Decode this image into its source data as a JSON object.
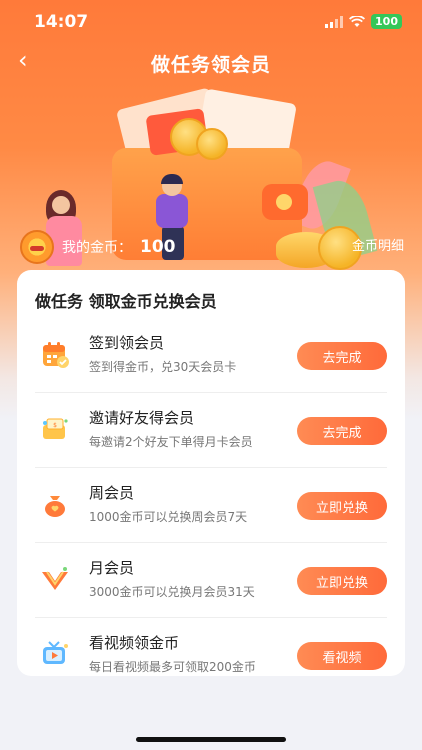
{
  "status": {
    "time": "14:07",
    "battery": "100"
  },
  "nav": {
    "back": "‹",
    "title": "做任务领会员"
  },
  "wallet": {
    "label": "我的金币：",
    "value": "100",
    "detail_link": "金币明细"
  },
  "card": {
    "title": "做任务  领取金币兑换会员",
    "tasks": [
      {
        "name": "签到领会员",
        "desc": "签到得金币，兑30天会员卡",
        "action": "去完成",
        "icon": "calendar-icon"
      },
      {
        "name": "邀请好友得会员",
        "desc": "每邀请2个好友下单得月卡会员",
        "action": "去完成",
        "icon": "invite-gift-icon"
      },
      {
        "name": "周会员",
        "desc": "1000金币可以兑换周会员7天",
        "action": "立即兑换",
        "icon": "money-bag-icon"
      },
      {
        "name": "月会员",
        "desc": "3000金币可以兑换月会员31天",
        "action": "立即兑换",
        "icon": "vip-badge-icon"
      },
      {
        "name": "看视频领金币",
        "desc": "每日看视频最多可领取200金币",
        "action": "看视频",
        "icon": "video-tv-icon"
      }
    ]
  },
  "colors": {
    "accent": "#ff7a3a",
    "button": "#ff6a3a"
  }
}
